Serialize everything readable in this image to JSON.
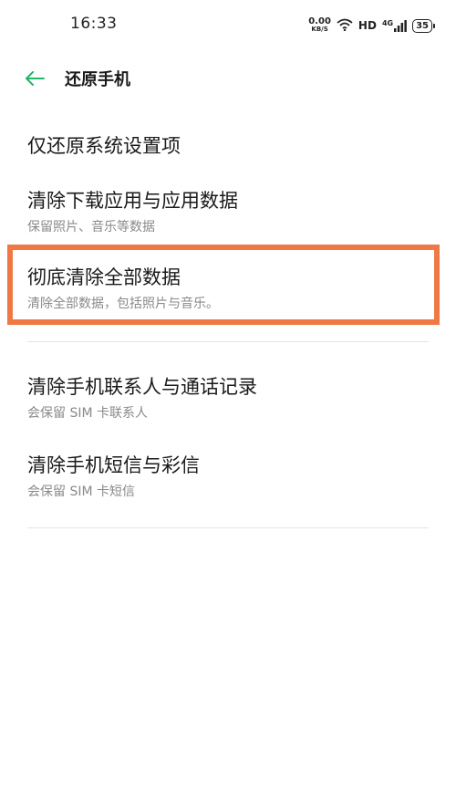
{
  "status_bar": {
    "time": "16:33",
    "net_speed_value": "0.00",
    "net_speed_unit": "KB/S",
    "hd_label": "HD",
    "signal_label": "4G",
    "battery_level": "35"
  },
  "header": {
    "title": "还原手机"
  },
  "items": [
    {
      "title": "仅还原系统设置项",
      "subtitle": ""
    },
    {
      "title": "清除下载应用与应用数据",
      "subtitle": "保留照片、音乐等数据"
    },
    {
      "title": "彻底清除全部数据",
      "subtitle": "清除全部数据，包括照片与音乐。"
    },
    {
      "title": "清除手机联系人与通话记录",
      "subtitle": "会保留 SIM 卡联系人"
    },
    {
      "title": "清除手机短信与彩信",
      "subtitle": "会保留 SIM 卡短信"
    }
  ],
  "colors": {
    "accent": "#1fb86a",
    "highlight": "#f07844"
  }
}
